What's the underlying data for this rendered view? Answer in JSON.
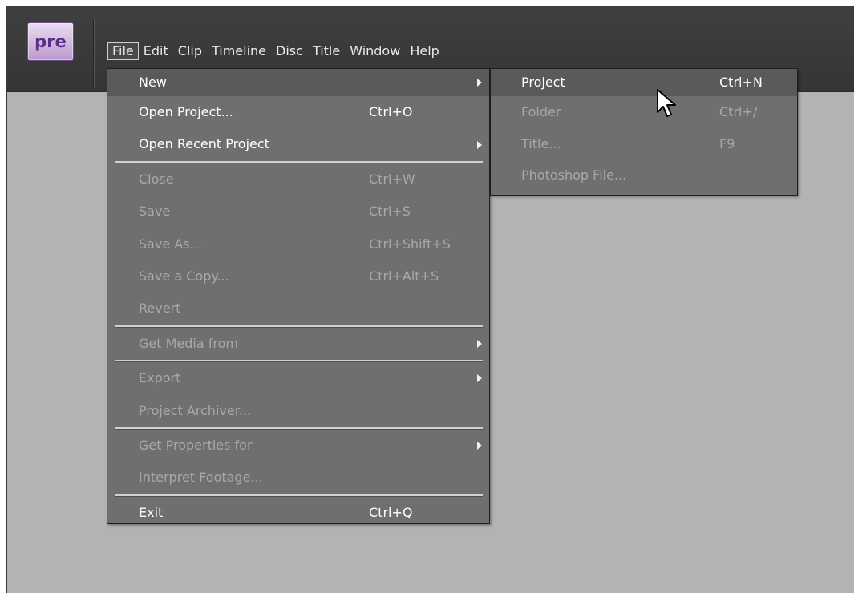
{
  "app": {
    "logo_text": "pre",
    "logo_color": "#5b2f86"
  },
  "menubar": {
    "items": [
      "File",
      "Edit",
      "Clip",
      "Timeline",
      "Disc",
      "Title",
      "Window",
      "Help"
    ],
    "active": "File"
  },
  "file_menu": {
    "items": [
      {
        "label": "New",
        "shortcut": "",
        "submenu": true,
        "enabled": true,
        "highlighted": true
      },
      {
        "label": "Open Project...",
        "shortcut": "Ctrl+O",
        "submenu": false,
        "enabled": true
      },
      {
        "label": "Open Recent Project",
        "shortcut": "",
        "submenu": true,
        "enabled": true
      },
      {
        "label": "Close",
        "shortcut": "Ctrl+W",
        "submenu": false,
        "enabled": false
      },
      {
        "label": "Save",
        "shortcut": "Ctrl+S",
        "submenu": false,
        "enabled": false
      },
      {
        "label": "Save As...",
        "shortcut": "Ctrl+Shift+S",
        "submenu": false,
        "enabled": false
      },
      {
        "label": "Save a Copy...",
        "shortcut": "Ctrl+Alt+S",
        "submenu": false,
        "enabled": false
      },
      {
        "label": "Revert",
        "shortcut": "",
        "submenu": false,
        "enabled": false
      },
      {
        "label": "Get Media from",
        "shortcut": "",
        "submenu": true,
        "enabled": false
      },
      {
        "label": "Export",
        "shortcut": "",
        "submenu": true,
        "enabled": false
      },
      {
        "label": "Project Archiver...",
        "shortcut": "",
        "submenu": false,
        "enabled": false
      },
      {
        "label": "Get Properties for",
        "shortcut": "",
        "submenu": true,
        "enabled": false
      },
      {
        "label": "Interpret Footage...",
        "shortcut": "",
        "submenu": false,
        "enabled": false
      },
      {
        "label": "Exit",
        "shortcut": "Ctrl+Q",
        "submenu": false,
        "enabled": true
      }
    ]
  },
  "new_submenu": {
    "items": [
      {
        "label": "Project",
        "shortcut": "Ctrl+N",
        "enabled": true,
        "highlighted": true
      },
      {
        "label": "Folder",
        "shortcut": "Ctrl+/",
        "enabled": false
      },
      {
        "label": "Title...",
        "shortcut": "F9",
        "enabled": false
      },
      {
        "label": "Photoshop File...",
        "shortcut": "",
        "enabled": false
      }
    ]
  },
  "icons": {
    "submenu_arrow": "triangle-right-icon",
    "cursor": "mouse-pointer-icon"
  }
}
